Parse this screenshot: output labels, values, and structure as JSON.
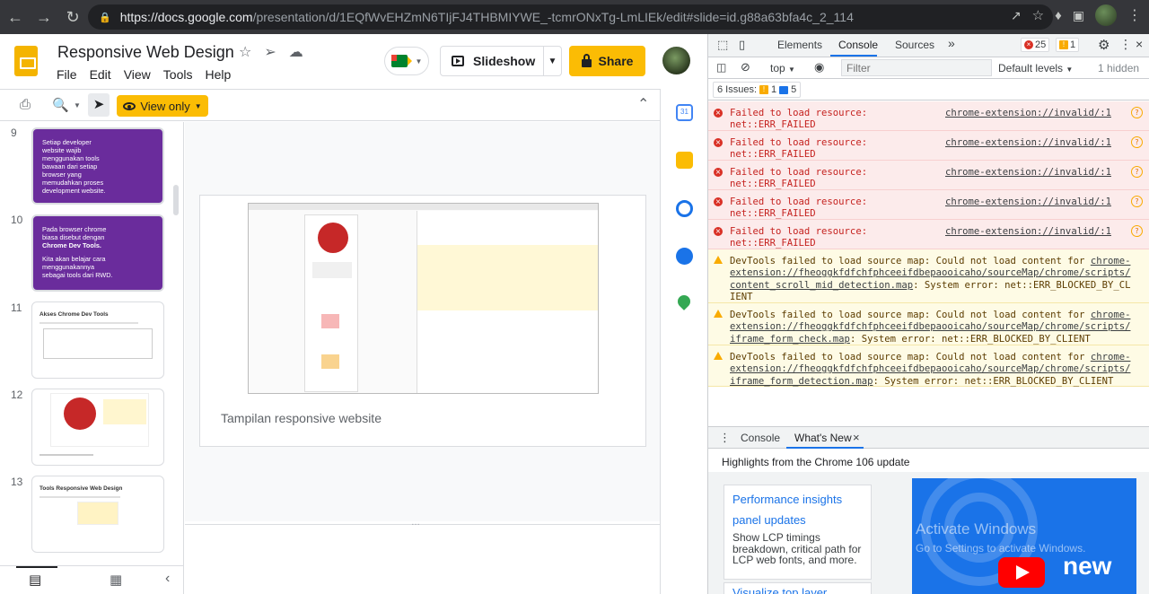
{
  "browser": {
    "url_host": "https://docs.google.com",
    "url_path": "/presentation/d/1EQfWvEHZmN6TIjFJ4THBMIYWE_-tcmrONxTg-LmLIEk/edit#slide=id.g88a63bfa4c_2_114"
  },
  "slides": {
    "doc_title": "Responsive Web Design",
    "menu": [
      "File",
      "Edit",
      "View",
      "Tools",
      "Help"
    ],
    "slideshow_label": "Slideshow",
    "share_label": "Share",
    "view_only_label": "View only",
    "filmstrip": [
      {
        "num": "9",
        "lines": [
          "Setiap developer",
          "website wajib",
          "menggunakan tools",
          "bawaan dari setiap",
          "browser yang",
          "memudahkan proses",
          "development website."
        ]
      },
      {
        "num": "10",
        "lines": [
          "Pada browser chrome",
          "biasa disebut dengan",
          "Chrome Dev Tools.",
          "",
          "Kita akan belajar cara",
          "menggunakannya",
          "sebagai tools dari RWD."
        ]
      },
      {
        "num": "11",
        "title": "Akses Chrome Dev Tools"
      },
      {
        "num": "12",
        "title": ""
      },
      {
        "num": "13",
        "title": "Tools Responsive Web Design"
      }
    ],
    "current_slide_caption": "Tampilan responsive website"
  },
  "devtools": {
    "tabs": [
      "Elements",
      "Console",
      "Sources"
    ],
    "more_tabs": "»",
    "error_count": "25",
    "warning_count": "1",
    "context": "top",
    "filter_placeholder": "Filter",
    "levels_label": "Default levels",
    "hidden_label": "1 hidden",
    "issues_label": "6 Issues:",
    "issues_warn": "1",
    "issues_info": "5",
    "messages": [
      {
        "type": "error",
        "text": "Failed to load resource:\nnet::ERR_FAILED",
        "source": "chrome-extension://invalid/:1"
      },
      {
        "type": "error",
        "text": "Failed to load resource:\nnet::ERR_FAILED",
        "source": "chrome-extension://invalid/:1"
      },
      {
        "type": "error",
        "text": "Failed to load resource:\nnet::ERR_FAILED",
        "source": "chrome-extension://invalid/:1"
      },
      {
        "type": "error",
        "text": "Failed to load resource:\nnet::ERR_FAILED",
        "source": "chrome-extension://invalid/:1"
      },
      {
        "type": "error",
        "text": "Failed to load resource:\nnet::ERR_FAILED",
        "source": "chrome-extension://invalid/:1"
      },
      {
        "type": "warning",
        "prefix": "DevTools failed to load source map: Could not load content for ",
        "link": "chrome-extension://fheoggkfdfchfphceeifdbepaooicaho/sourceMap/chrome/scripts/content_scroll_mid_detection.map",
        "suffix": ": System error: net::ERR_BLOCKED_BY_CLIENT"
      },
      {
        "type": "warning",
        "prefix": "DevTools failed to load source map: Could not load content for ",
        "link": "chrome-extension://fheoggkfdfchfphceeifdbepaooicaho/sourceMap/chrome/scripts/iframe_form_check.map",
        "suffix": ": System error: net::ERR_BLOCKED_BY_CLIENT"
      },
      {
        "type": "warning",
        "prefix": "DevTools failed to load source map: Could not load content for ",
        "link": "chrome-extension://fheoggkfdfchfphceeifdbepaooicaho/sourceMap/chrome/scripts/iframe_form_detection.map",
        "suffix": ": System error: net::ERR_BLOCKED_BY_CLIENT"
      }
    ],
    "drawer_tabs": [
      "Console",
      "What's New"
    ],
    "whats_new_heading": "Highlights from the Chrome 106 update",
    "card_link_1": "Performance insights",
    "card_link_2": "panel updates",
    "card_desc": "Show LCP timings breakdown, critical path for LCP web fonts, and more.",
    "card2_link": "Visualize top layer",
    "video_label": "new",
    "watermark_1": "Activate Windows",
    "watermark_2": "Go to Settings to activate Windows."
  }
}
